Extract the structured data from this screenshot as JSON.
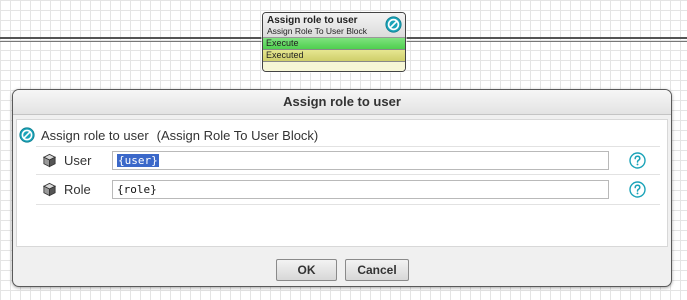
{
  "canvas_block": {
    "title": "Assign role to user",
    "subtitle": "Assign Role To User Block",
    "input_port": "Execute",
    "output_port": "Executed",
    "icon": "role-assign-icon"
  },
  "dialog": {
    "title": "Assign role to user",
    "heading": "Assign role to user",
    "heading_type": "(Assign Role To User Block)",
    "heading_icon": "role-assign-icon",
    "params": [
      {
        "label": "User",
        "value": "{user}",
        "icon": "cube-icon",
        "help_icon": "help-icon",
        "selected": true
      },
      {
        "label": "Role",
        "value": "{role}",
        "icon": "cube-icon",
        "help_icon": "help-icon",
        "selected": false
      }
    ],
    "buttons": {
      "ok": "OK",
      "cancel": "Cancel"
    }
  },
  "colors": {
    "accent_teal": "#1aa3b8",
    "port_in": "#5ad35a",
    "port_out": "#d4d46f",
    "selection": "#3b68c9"
  }
}
